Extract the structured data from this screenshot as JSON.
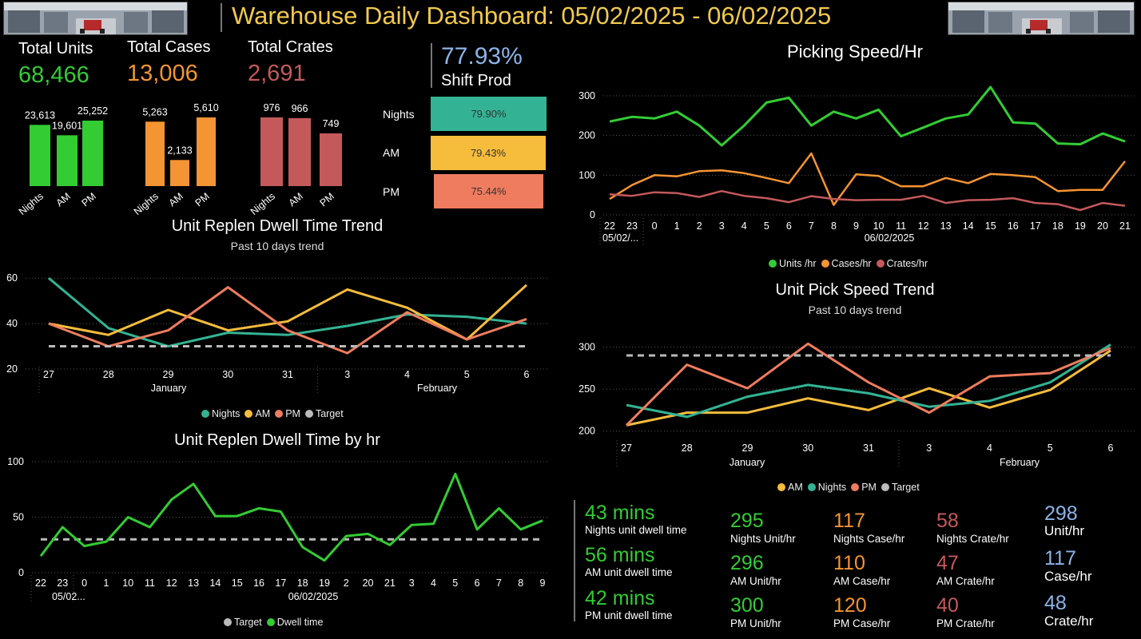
{
  "header": {
    "title": "Warehouse Daily Dashboard: 05/02/2025 - 06/02/2025"
  },
  "colors": {
    "green": "#33cc33",
    "orange": "#f59432",
    "red": "#c4595b",
    "teal": "#33b394",
    "yellow": "#f6bc3c",
    "salmon": "#ef7c5e",
    "blue": "#8cb4e8",
    "title_yellow": "#f2c94c"
  },
  "kpis": [
    {
      "label": "Total Units",
      "value": "68,466",
      "color": "#33cc33"
    },
    {
      "label": "Total Cases",
      "value": "13,006",
      "color": "#f59432"
    },
    {
      "label": "Total Crates",
      "value": "2,691",
      "color": "#c4595b"
    }
  ],
  "shift_prod": {
    "value": "77.93%",
    "label": "Shift Prod",
    "rows": [
      {
        "name": "Nights",
        "pct": "79.90%",
        "value": 79.9,
        "color": "#33b394"
      },
      {
        "name": "AM",
        "pct": "79.43%",
        "value": 79.43,
        "color": "#f6bc3c"
      },
      {
        "name": "PM",
        "pct": "75.44%",
        "value": 75.44,
        "color": "#ef7c5e"
      }
    ]
  },
  "chart_data": [
    {
      "id": "mini-units",
      "type": "bar",
      "categories": [
        "Nights",
        "AM",
        "PM"
      ],
      "values": [
        23613,
        19601,
        25252
      ],
      "labels": [
        "23,613",
        "19,601",
        "25,252"
      ],
      "color": "#33cc33"
    },
    {
      "id": "mini-cases",
      "type": "bar",
      "categories": [
        "Nights",
        "AM",
        "PM"
      ],
      "values": [
        5263,
        2133,
        5610
      ],
      "labels": [
        "5,263",
        "2,133",
        "5,610"
      ],
      "color": "#f59432"
    },
    {
      "id": "mini-crates",
      "type": "bar",
      "categories": [
        "Nights",
        "AM",
        "PM"
      ],
      "values": [
        976,
        966,
        749
      ],
      "labels": [
        "976",
        "966",
        "749"
      ],
      "color": "#c4595b"
    },
    {
      "id": "picking-speed",
      "type": "line",
      "title": "Picking Speed/Hr",
      "x": [
        "22",
        "23",
        "0",
        "1",
        "2",
        "3",
        "4",
        "5",
        "6",
        "7",
        "8",
        "9",
        "10",
        "11",
        "12",
        "13",
        "14",
        "15",
        "16",
        "17",
        "18",
        "19",
        "20",
        "21"
      ],
      "group_labels": [
        "05/02/...",
        "06/02/2025"
      ],
      "ylim": [
        0,
        320
      ],
      "yticks": [
        0,
        100,
        200,
        300
      ],
      "series": [
        {
          "name": "Units /hr",
          "color": "#33cc33",
          "values": [
            235,
            247,
            243,
            260,
            225,
            175,
            225,
            283,
            295,
            225,
            260,
            243,
            265,
            198,
            220,
            243,
            253,
            322,
            233,
            230,
            180,
            178,
            205,
            185
          ]
        },
        {
          "name": "Cases/hr",
          "color": "#f59432",
          "values": [
            40,
            75,
            100,
            97,
            110,
            112,
            105,
            93,
            80,
            155,
            25,
            102,
            98,
            72,
            72,
            93,
            80,
            103,
            100,
            95,
            60,
            63,
            63,
            135
          ]
        },
        {
          "name": "Crates/hr",
          "color": "#c4595b",
          "values": [
            52,
            48,
            57,
            55,
            45,
            60,
            48,
            42,
            32,
            47,
            40,
            37,
            38,
            38,
            48,
            30,
            37,
            38,
            42,
            30,
            27,
            12,
            30,
            23
          ]
        }
      ]
    },
    {
      "id": "dwell-trend",
      "type": "line",
      "title": "Unit Replen Dwell Time Trend",
      "subtitle": "Past 10 days trend",
      "x": [
        "27",
        "28",
        "29",
        "30",
        "31",
        "3",
        "4",
        "5",
        "6"
      ],
      "group_labels": [
        "January",
        "February"
      ],
      "ylim": [
        20,
        65
      ],
      "yticks": [
        20,
        40,
        60
      ],
      "series": [
        {
          "name": "Nights",
          "color": "#33b394",
          "values": [
            60,
            38,
            30,
            36,
            35,
            39,
            44,
            43,
            40
          ]
        },
        {
          "name": "AM",
          "color": "#f6bc3c",
          "values": [
            40,
            35,
            46,
            37,
            41,
            55,
            47,
            33,
            57
          ]
        },
        {
          "name": "PM",
          "color": "#ef7c5e",
          "values": [
            40,
            30,
            37,
            56,
            37,
            27,
            45,
            33,
            42
          ]
        },
        {
          "name": "Target",
          "color": "#bbbbbb",
          "values": [
            30,
            30,
            30,
            30,
            30,
            30,
            30,
            30,
            30
          ],
          "dashed": true
        }
      ]
    },
    {
      "id": "dwell-hr",
      "type": "line",
      "title": "Unit Replen Dwell Time by hr",
      "x": [
        "22",
        "23",
        "0",
        "1",
        "10",
        "11",
        "12",
        "13",
        "14",
        "15",
        "16",
        "17",
        "18",
        "19",
        "2",
        "20",
        "21",
        "3",
        "4",
        "5",
        "6",
        "7",
        "8",
        "9"
      ],
      "group_labels": [
        "05/02...",
        "06/02/2025"
      ],
      "ylim": [
        0,
        100
      ],
      "yticks": [
        0,
        50,
        100
      ],
      "series": [
        {
          "name": "Target",
          "color": "#bbbbbb",
          "values": [
            30,
            30,
            30,
            30,
            30,
            30,
            30,
            30,
            30,
            30,
            30,
            30,
            30,
            30,
            30,
            30,
            30,
            30,
            30,
            30,
            30,
            30,
            30,
            30
          ],
          "dashed": true
        },
        {
          "name": "Dwell time",
          "color": "#33cc33",
          "values": [
            15,
            41,
            24,
            28,
            50,
            41,
            66,
            80,
            51,
            51,
            58,
            55,
            23,
            11,
            33,
            35,
            25,
            43,
            44,
            89,
            39,
            58,
            39,
            47
          ]
        }
      ]
    },
    {
      "id": "pick-speed-trend",
      "type": "line",
      "title": "Unit Pick Speed Trend",
      "subtitle": "Past 10 days trend",
      "x": [
        "27",
        "28",
        "29",
        "30",
        "31",
        "3",
        "4",
        "5",
        "6"
      ],
      "group_labels": [
        "January",
        "February"
      ],
      "ylim": [
        195,
        310
      ],
      "yticks": [
        200,
        250,
        300
      ],
      "series": [
        {
          "name": "AM",
          "color": "#f6bc3c",
          "values": [
            207,
            222,
            222,
            239,
            225,
            251,
            228,
            249,
            296
          ]
        },
        {
          "name": "Nights",
          "color": "#33b394",
          "values": [
            231,
            217,
            241,
            255,
            245,
            229,
            236,
            258,
            303
          ]
        },
        {
          "name": "PM",
          "color": "#ef7c5e",
          "values": [
            207,
            279,
            251,
            304,
            258,
            222,
            265,
            269,
            299
          ]
        },
        {
          "name": "Target",
          "color": "#bbbbbb",
          "values": [
            290,
            290,
            290,
            290,
            290,
            290,
            290,
            290,
            290
          ],
          "dashed": true
        }
      ]
    }
  ],
  "dwell_stats": [
    {
      "value": "43 mins",
      "label": "Nights unit dwell time"
    },
    {
      "value": "56 mins",
      "label": "AM unit dwell time"
    },
    {
      "value": "42 mins",
      "label": "PM unit dwell time"
    }
  ],
  "rates": {
    "units": [
      {
        "value": "295",
        "label": "Nights Unit/hr"
      },
      {
        "value": "296",
        "label": "AM Unit/hr"
      },
      {
        "value": "300",
        "label": "PM Unit/hr"
      }
    ],
    "cases": [
      {
        "value": "117",
        "label": "Nights Case/hr"
      },
      {
        "value": "110",
        "label": "AM Case/hr"
      },
      {
        "value": "120",
        "label": "PM Case/hr"
      }
    ],
    "crates": [
      {
        "value": "58",
        "label": "Nights Crate/hr"
      },
      {
        "value": "47",
        "label": "AM Crate/hr"
      },
      {
        "value": "40",
        "label": "PM Crate/hr"
      }
    ],
    "totals": [
      {
        "value": "298",
        "label": "Unit/hr"
      },
      {
        "value": "117",
        "label": "Case/hr"
      },
      {
        "value": "48",
        "label": "Crate/hr"
      }
    ]
  }
}
